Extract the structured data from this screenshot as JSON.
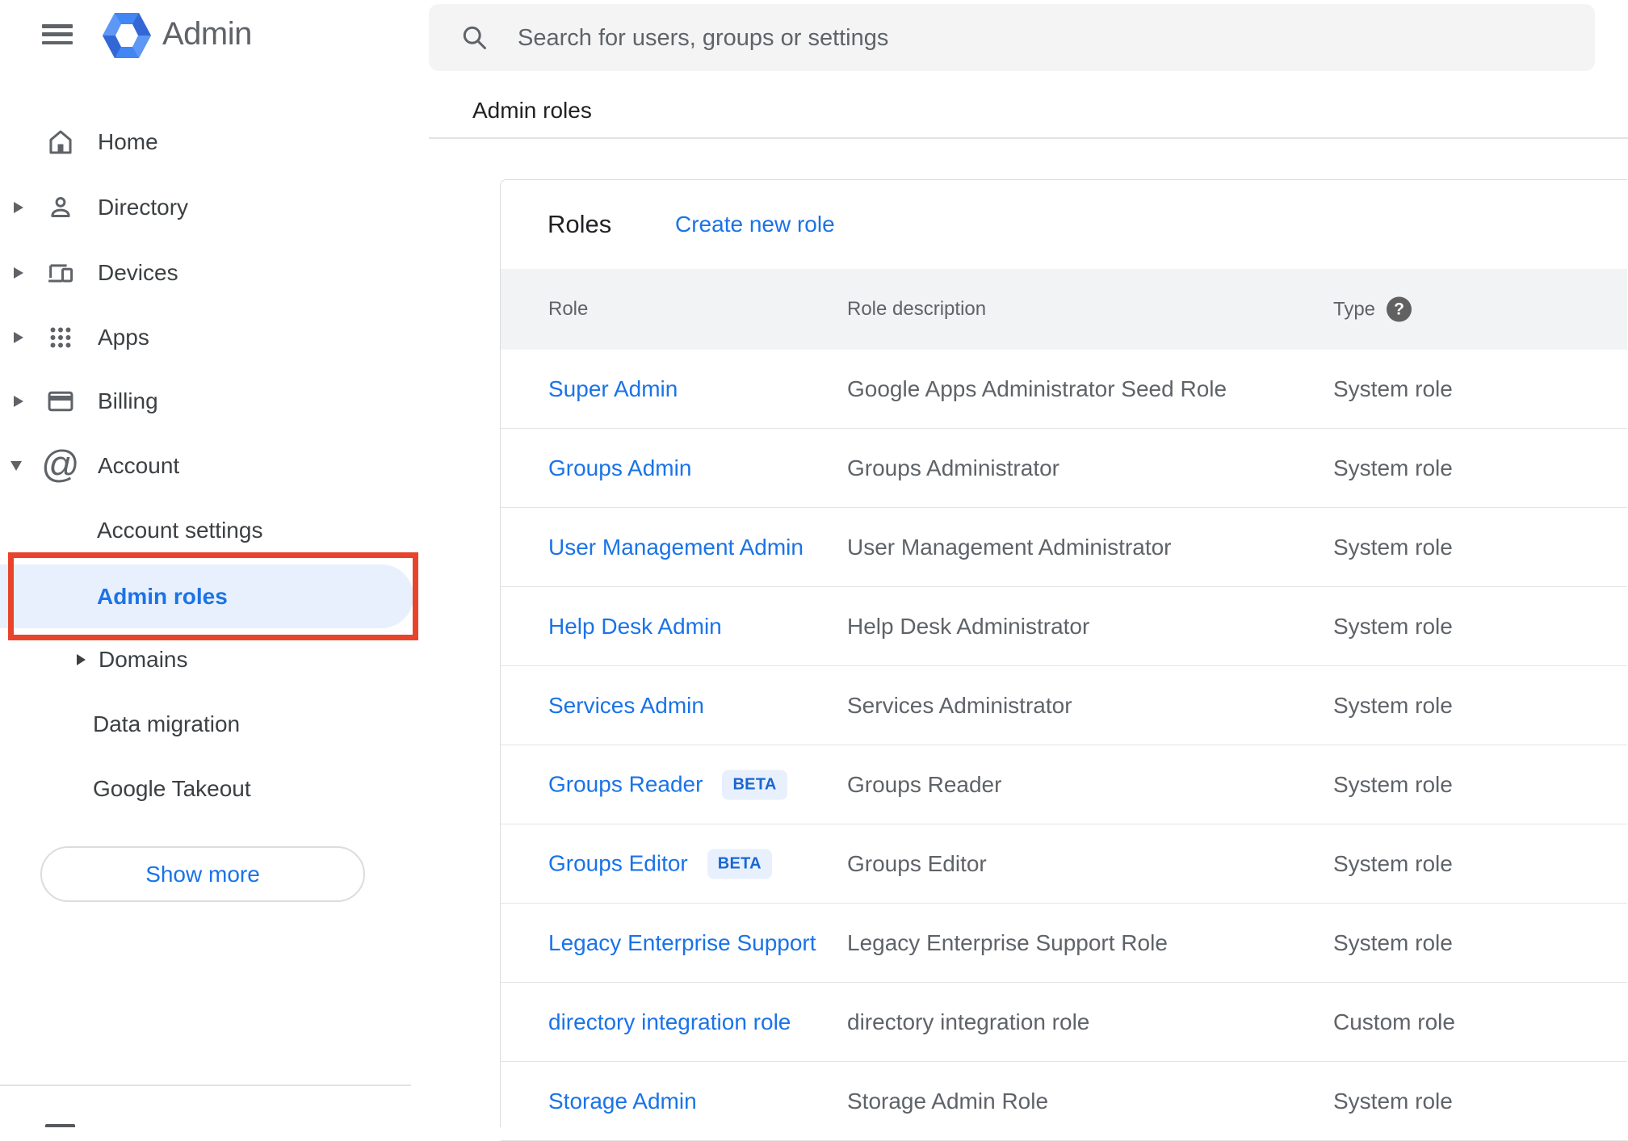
{
  "app": {
    "title": "Admin"
  },
  "search": {
    "placeholder": "Search for users, groups or settings"
  },
  "sidebar": {
    "home": "Home",
    "directory": "Directory",
    "devices": "Devices",
    "apps": "Apps",
    "billing": "Billing",
    "account": "Account",
    "account_settings": "Account settings",
    "admin_roles": "Admin roles",
    "domains": "Domains",
    "data_migration": "Data migration",
    "google_takeout": "Google Takeout",
    "show_more": "Show more"
  },
  "page": {
    "heading": "Admin roles"
  },
  "roles_card": {
    "title": "Roles",
    "create_link": "Create new role",
    "beta_label": "BETA",
    "columns": {
      "role": "Role",
      "description": "Role description",
      "type": "Type"
    },
    "help_glyph": "?",
    "rows": [
      {
        "role": "Super Admin",
        "beta": false,
        "description": "Google Apps Administrator Seed Role",
        "type": "System role"
      },
      {
        "role": "Groups Admin",
        "beta": false,
        "description": "Groups Administrator",
        "type": "System role"
      },
      {
        "role": "User Management Admin",
        "beta": false,
        "description": "User Management Administrator",
        "type": "System role"
      },
      {
        "role": "Help Desk Admin",
        "beta": false,
        "description": "Help Desk Administrator",
        "type": "System role"
      },
      {
        "role": "Services Admin",
        "beta": false,
        "description": "Services Administrator",
        "type": "System role"
      },
      {
        "role": "Groups Reader",
        "beta": true,
        "description": "Groups Reader",
        "type": "System role"
      },
      {
        "role": "Groups Editor",
        "beta": true,
        "description": "Groups Editor",
        "type": "System role"
      },
      {
        "role": "Legacy Enterprise Support",
        "beta": false,
        "description": "Legacy Enterprise Support Role",
        "type": "System role"
      },
      {
        "role": "directory integration role",
        "beta": false,
        "description": "directory integration role",
        "type": "Custom role"
      },
      {
        "role": "Storage Admin",
        "beta": false,
        "description": "Storage Admin Role",
        "type": "System role"
      }
    ]
  },
  "colors": {
    "accent_blue": "#1a73e8",
    "active_item_bg": "#e8f0fe",
    "annotation_red": "#e8442c",
    "beta_text": "#1967d2",
    "table_header_bg": "#f1f3f4"
  }
}
